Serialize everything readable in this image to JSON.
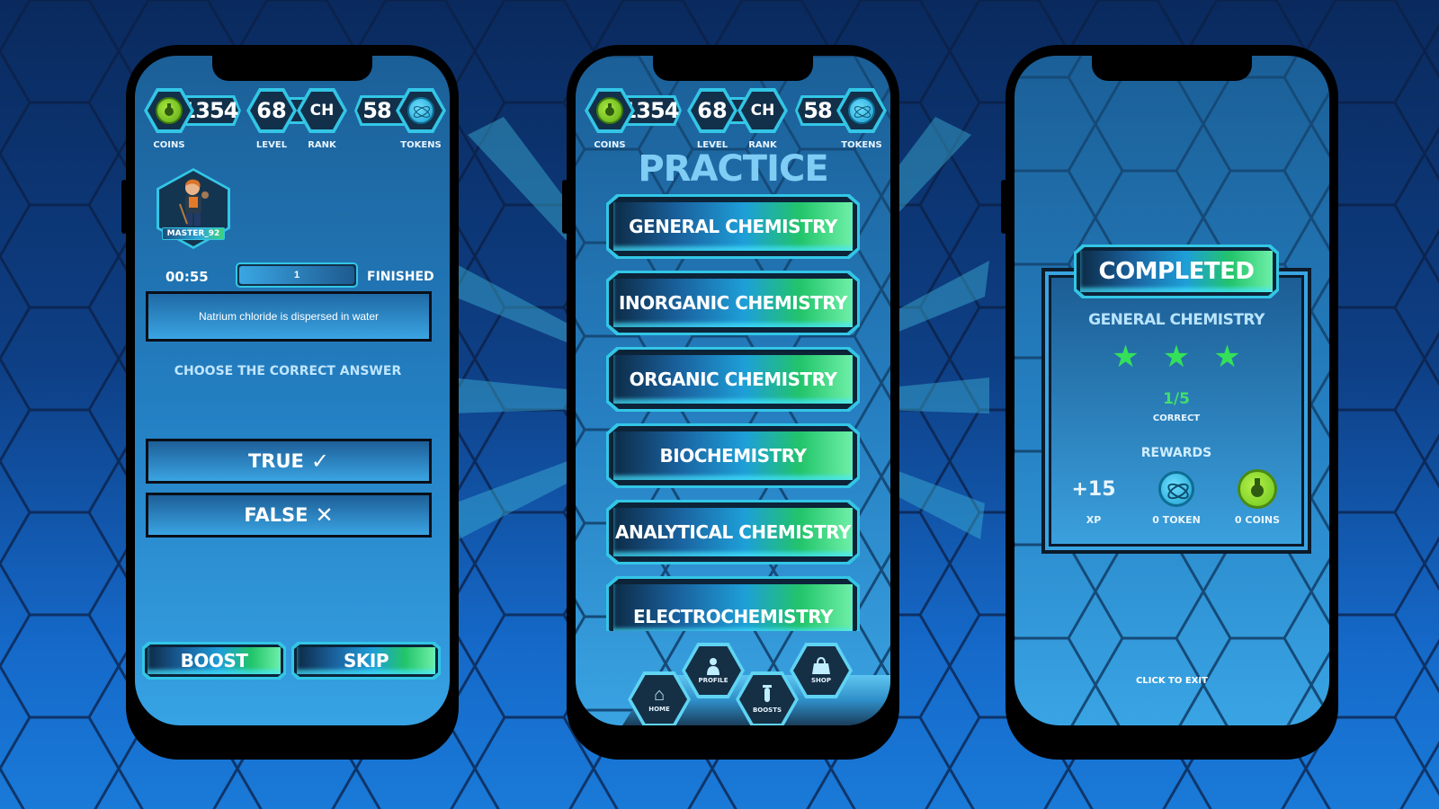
{
  "hud": {
    "coins_value": "1354",
    "coins_label": "COINS",
    "level_value": "68",
    "level_label": "LEVEL",
    "rank_value": "CH",
    "rank_label": "RANK",
    "tokens_value": "58",
    "tokens_label": "TOKENS"
  },
  "quiz_screen": {
    "username": "MASTER_92",
    "timer": "00:55",
    "progress_text": "1",
    "progress_fraction": 1.0,
    "finished_label": "FINISHED",
    "question": "Natrium chloride is dispersed in water",
    "instruction": "CHOOSE THE CORRECT ANSWER",
    "true_label": "TRUE",
    "true_icon": "check-icon",
    "false_label": "FALSE",
    "false_icon": "x-icon",
    "boost_label": "BOOST",
    "skip_label": "SKIP"
  },
  "practice_screen": {
    "title": "PRACTICE",
    "categories": [
      {
        "label": "GENERAL CHEMISTRY"
      },
      {
        "label": "INORGANIC CHEMISTRY"
      },
      {
        "label": "ORGANIC CHEMISTRY"
      },
      {
        "label": "BIOCHEMISTRY"
      },
      {
        "label": "ANALYTICAL CHEMISTRY"
      },
      {
        "label": "ELECTROCHEMISTRY"
      }
    ],
    "nav": [
      {
        "label": "HOME",
        "icon": "home-icon"
      },
      {
        "label": "PROFILE",
        "icon": "profile-icon"
      },
      {
        "label": "BOOSTS",
        "icon": "test-tube-icon"
      },
      {
        "label": "SHOP",
        "icon": "shopping-bag-icon"
      }
    ]
  },
  "result_screen": {
    "banner": "COMPLETED",
    "subject": "GENERAL CHEMISTRY",
    "stars_earned": 3,
    "stars_total": 3,
    "score": "1/5",
    "score_label": "CORRECT",
    "rewards_label": "REWARDS",
    "xp_value": "+15",
    "xp_label": "XP",
    "token_label": "0 TOKEN",
    "coins_label": "0 COINS",
    "exit_label": "CLICK TO EXIT"
  },
  "colors": {
    "accent_cyan": "#33c6e6",
    "accent_green": "#22c46a",
    "star_green": "#34e05a",
    "score_green": "#3fe06a",
    "panel_dark": "#12304a"
  }
}
